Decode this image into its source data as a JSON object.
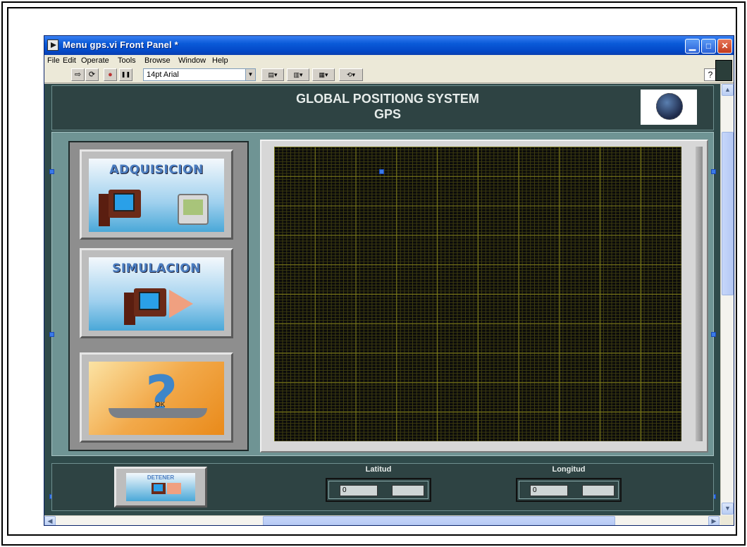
{
  "window": {
    "title": "Menu gps.vi Front Panel *",
    "minimize": "▁",
    "maximize": "□",
    "close": "✕"
  },
  "menubar": {
    "items": [
      "File",
      "Edit",
      "Operate",
      "Tools",
      "Browse",
      "Window",
      "Help"
    ]
  },
  "toolbar": {
    "run_icon": "⇨",
    "run_continuous_icon": "⟳",
    "abort_icon": "●",
    "pause_icon": "❚❚",
    "font_selector": "14pt Arial",
    "help_icon": "?"
  },
  "panel": {
    "title_line1": "GLOBAL POSITIONG SYSTEM",
    "title_line2": "GPS",
    "buttons": {
      "adquisicion": "ADQUISICION",
      "simulacion": "SIMULACION",
      "help_ok": "OK",
      "detener": "DETENER"
    },
    "latitud": {
      "label": "Latitud",
      "value": "0"
    },
    "longitud": {
      "label": "Longitud",
      "value": "0"
    }
  },
  "colors": {
    "panel_bg": "#2f4a4a",
    "body_bg": "#6f9494",
    "graph_bg": "#0a0a0a",
    "grid_major": "#7c7a1a",
    "titlebar": "#0a5ad8"
  }
}
